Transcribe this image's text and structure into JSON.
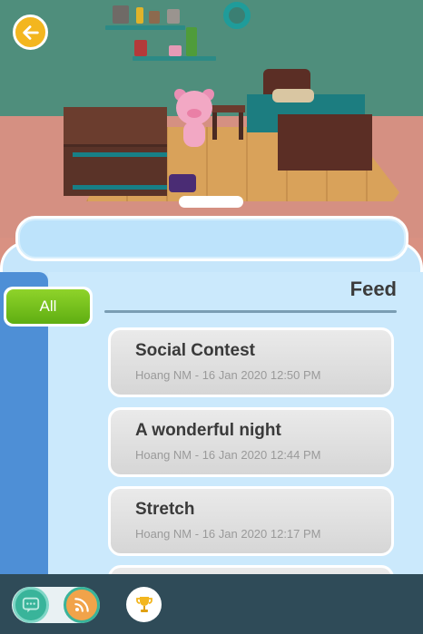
{
  "scene": {
    "colors": {
      "wall": "#4f8e7c",
      "floor": "#d9a25a",
      "back_button": "#f3b61f"
    },
    "back_icon": "arrow-left-icon"
  },
  "filters": {
    "selected": "All",
    "items": [
      {
        "label": "All"
      }
    ]
  },
  "feed": {
    "title": "Feed",
    "items": [
      {
        "title": "Social Contest",
        "meta": "Hoang NM - 16 Jan 2020 12:50 PM"
      },
      {
        "title": "A wonderful night",
        "meta": "Hoang NM - 16 Jan 2020 12:44 PM"
      },
      {
        "title": "Stretch",
        "meta": "Hoang NM - 16 Jan 2020 12:17 PM"
      }
    ]
  },
  "toolbar": {
    "buttons": [
      {
        "icon": "chat-icon",
        "color": "#39b49a"
      },
      {
        "icon": "rss-icon",
        "color": "#f1a34a"
      },
      {
        "icon": "trophy-icon",
        "color": "#f3b61f"
      }
    ]
  }
}
